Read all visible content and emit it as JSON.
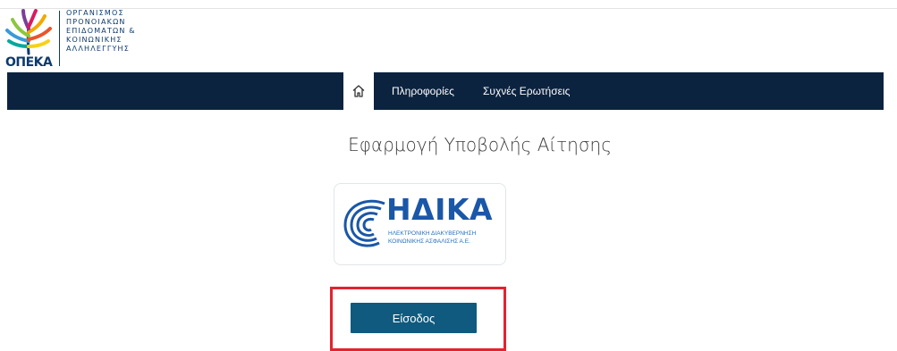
{
  "logo": {
    "abbr": "ΟΠΕΚΑ",
    "lines": [
      "ΟΡΓΑΝΙΣΜΟΣ",
      "ΠΡΟΝΟΙΑΚΩΝ",
      "ΕΠΙΔΟΜΑΤΩΝ &",
      "ΚΟΙΝΩΝΙΚΗΣ",
      "ΑΛΛΗΛΕΓΓΥΗΣ"
    ]
  },
  "nav": {
    "home_icon": "home-icon",
    "info_label": "Πληροφορίες",
    "faq_label": "Συχνές Ερωτήσεις"
  },
  "main": {
    "title": "Εφαρμογή Υποβολής Αίτησης",
    "provider": {
      "name": "ΗΔΙΚΑ",
      "subtitle_1": "ΗΛΕΚΤΡΟΝΙΚΗ ΔΙΑΚΥΒΕΡΝΗΣΗ",
      "subtitle_2": "ΚΟΙΝΩΝΙΚΗΣ ΑΣΦΑΛΙΣΗΣ Α.Ε."
    },
    "login_label": "Είσοδος"
  },
  "colors": {
    "navbar": "#0c2340",
    "brand_blue": "#1a57a8",
    "button": "#0f5a7e",
    "highlight": "#e3232f"
  }
}
